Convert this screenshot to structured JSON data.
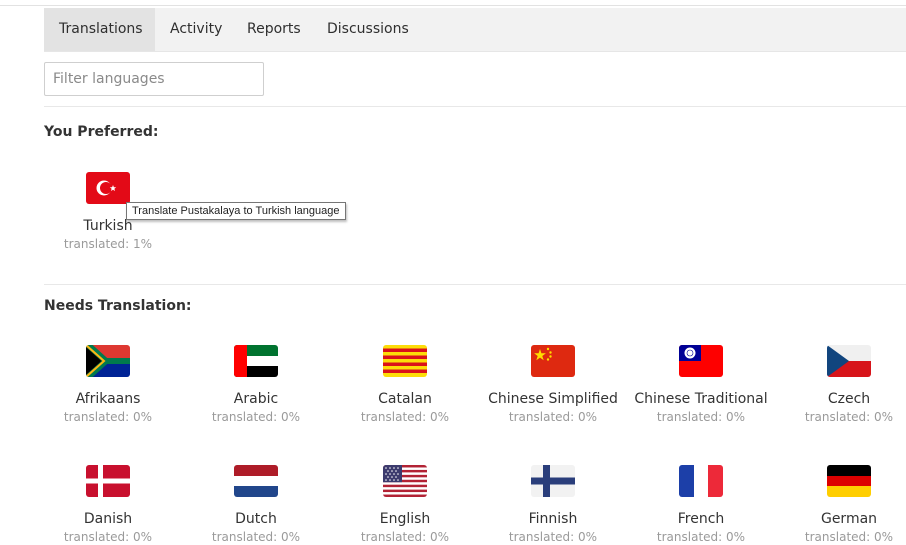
{
  "tabs": [
    {
      "label": "Translations",
      "active": true
    },
    {
      "label": "Activity",
      "active": false
    },
    {
      "label": "Reports",
      "active": false
    },
    {
      "label": "Discussions",
      "active": false
    }
  ],
  "filter": {
    "placeholder": "Filter languages",
    "value": ""
  },
  "preferred": {
    "title": "You Preferred:",
    "languages": [
      {
        "name": "Turkish",
        "status": "translated: 1%",
        "flag": "turkey-flag"
      }
    ]
  },
  "tooltip": "Translate Pustakalaya to Turkish language",
  "needs": {
    "title": "Needs Translation:",
    "languages": [
      {
        "name": "Afrikaans",
        "status": "translated: 0%",
        "flag": "south-africa-flag"
      },
      {
        "name": "Arabic",
        "status": "translated: 0%",
        "flag": "uae-flag"
      },
      {
        "name": "Catalan",
        "status": "translated: 0%",
        "flag": "catalonia-flag"
      },
      {
        "name": "Chinese Simplified",
        "status": "translated: 0%",
        "flag": "china-flag"
      },
      {
        "name": "Chinese Traditional",
        "status": "translated: 0%",
        "flag": "taiwan-flag"
      },
      {
        "name": "Czech",
        "status": "translated: 0%",
        "flag": "czech-flag"
      },
      {
        "name": "Danish",
        "status": "translated: 0%",
        "flag": "denmark-flag"
      },
      {
        "name": "Dutch",
        "status": "translated: 0%",
        "flag": "netherlands-flag"
      },
      {
        "name": "English",
        "status": "translated: 0%",
        "flag": "usa-flag"
      },
      {
        "name": "Finnish",
        "status": "translated: 0%",
        "flag": "finland-flag"
      },
      {
        "name": "French",
        "status": "translated: 0%",
        "flag": "france-flag"
      },
      {
        "name": "German",
        "status": "translated: 0%",
        "flag": "germany-flag"
      }
    ]
  },
  "colors": {
    "tab_bg": "#f2f2f2",
    "active_tab_bg": "#e3e3e3",
    "muted_text": "#9a9a9a"
  }
}
